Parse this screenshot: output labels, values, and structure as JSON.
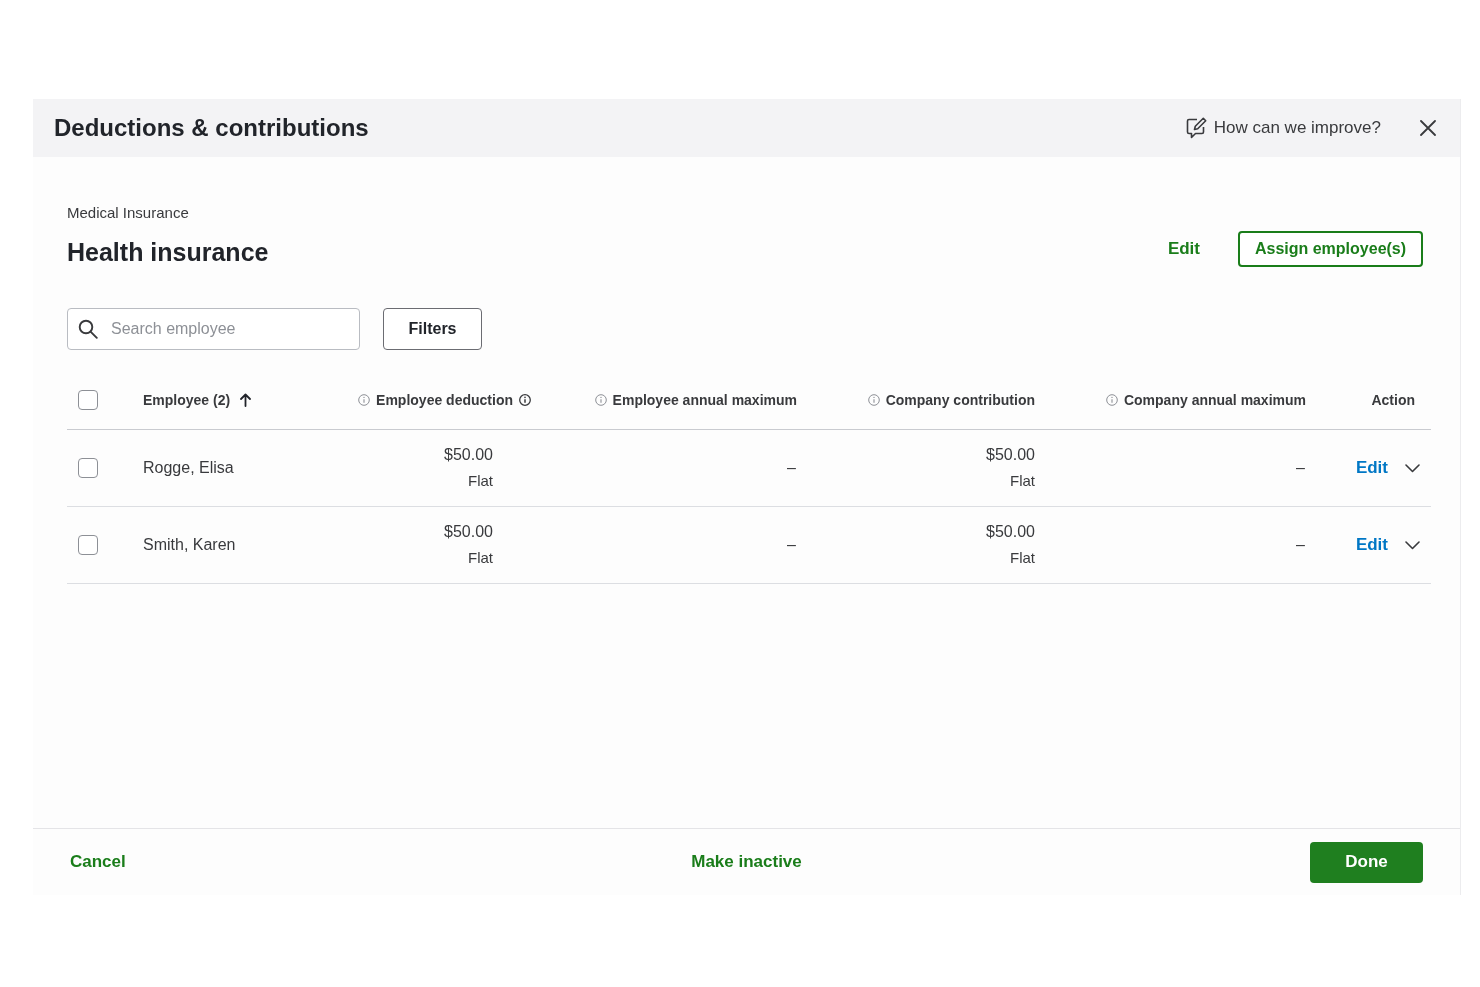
{
  "dialog": {
    "title": "Deductions & contributions",
    "feedback_link": "How can we improve?"
  },
  "plan": {
    "category": "Medical Insurance",
    "name": "Health insurance",
    "edit_link": "Edit",
    "assign_button": "Assign employee(s)"
  },
  "search": {
    "placeholder": "Search employee"
  },
  "filters_button": "Filters",
  "table": {
    "select_all": {
      "checked": false
    },
    "columns": [
      {
        "label": "Employee (2)",
        "kind": "sortable",
        "sort_ascending": true
      },
      {
        "label": "Employee deduction",
        "kind": "info-hint"
      },
      {
        "label": "Employee annual maximum",
        "kind": "info"
      },
      {
        "label": "Company contribution",
        "kind": "info"
      },
      {
        "label": "Company annual maximum",
        "kind": "info"
      },
      {
        "label": "Action",
        "kind": "plain"
      }
    ],
    "rows": [
      {
        "checked": false,
        "employee": "Rogge, Elisa",
        "employee_deduction": {
          "amount": "$50.00",
          "type": "Flat"
        },
        "employee_annual_maximum": "–",
        "company_contribution": {
          "amount": "$50.00",
          "type": "Flat"
        },
        "company_annual_maximum": "–",
        "action": "Edit"
      },
      {
        "checked": false,
        "employee": "Smith, Karen",
        "employee_deduction": {
          "amount": "$50.00",
          "type": "Flat"
        },
        "employee_annual_maximum": "–",
        "company_contribution": {
          "amount": "$50.00",
          "type": "Flat"
        },
        "company_annual_maximum": "–",
        "action": "Edit"
      }
    ]
  },
  "footer": {
    "cancel": "Cancel",
    "make_inactive": "Make inactive",
    "done": "Done"
  }
}
